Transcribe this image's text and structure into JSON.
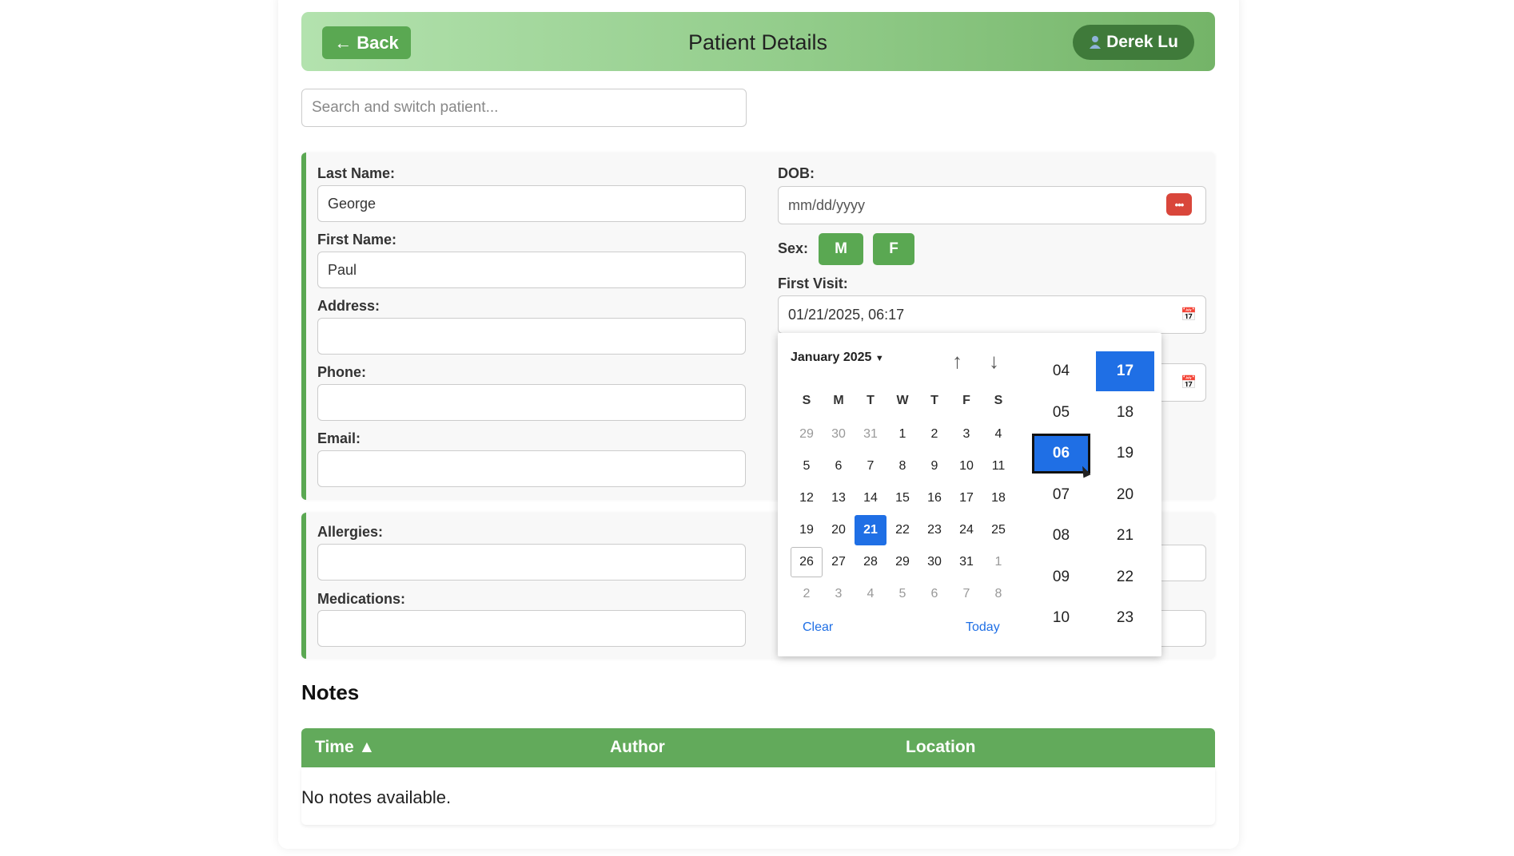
{
  "header": {
    "back_label": "Back",
    "back_icon": "arrow-left-icon",
    "title": "Patient Details",
    "user_name": "Derek Lu",
    "user_icon": "person-icon"
  },
  "search": {
    "placeholder": "Search and switch patient..."
  },
  "form": {
    "last_name_label": "Last Name:",
    "last_name_value": "George",
    "first_name_label": "First Name:",
    "first_name_value": "Paul",
    "address_label": "Address:",
    "address_value": "",
    "phone_label": "Phone:",
    "phone_value": "",
    "email_label": "Email:",
    "email_value": "",
    "dob_label": "DOB:",
    "dob_placeholder": "mm/dd/yyyy",
    "sex_label": "Sex:",
    "sex_options": [
      "M",
      "F"
    ],
    "first_visit_label": "First Visit:",
    "first_visit_value": "01/21/2025, 06:17",
    "allergies_label": "Allergies:",
    "allergies_value": "",
    "medications_label": "Medications:",
    "medications_value": ""
  },
  "datepicker": {
    "month_label": "January 2025",
    "weekdays": [
      "S",
      "M",
      "T",
      "W",
      "T",
      "F",
      "S"
    ],
    "weeks": [
      [
        "29",
        "30",
        "31",
        "1",
        "2",
        "3",
        "4"
      ],
      [
        "5",
        "6",
        "7",
        "8",
        "9",
        "10",
        "11"
      ],
      [
        "12",
        "13",
        "14",
        "15",
        "16",
        "17",
        "18"
      ],
      [
        "19",
        "20",
        "21",
        "22",
        "23",
        "24",
        "25"
      ],
      [
        "26",
        "27",
        "28",
        "29",
        "30",
        "31",
        "1"
      ],
      [
        "2",
        "3",
        "4",
        "5",
        "6",
        "7",
        "8"
      ]
    ],
    "selected_day": "21",
    "today_day": "26",
    "clear_label": "Clear",
    "today_label": "Today",
    "hours": [
      "04",
      "05",
      "06",
      "07",
      "08",
      "09",
      "10"
    ],
    "minutes": [
      "17",
      "18",
      "19",
      "20",
      "21",
      "22",
      "23"
    ],
    "selected_hour": "06",
    "selected_minute": "17",
    "accent_color": "#1f6fe5"
  },
  "notes": {
    "title": "Notes",
    "columns": [
      "Time ▲",
      "Author",
      "Location"
    ],
    "empty_text": "No notes available."
  },
  "colors": {
    "primary_green": "#5aa852",
    "dark_green": "#3f7a3a",
    "dob_icon_red": "#d9463b"
  }
}
